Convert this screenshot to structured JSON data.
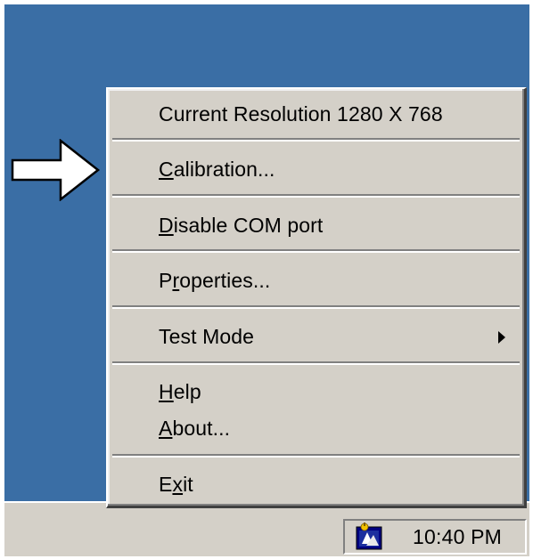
{
  "menu": {
    "resolution_label": "Current Resolution  1280 X 768",
    "calibration": {
      "mnemonic": "C",
      "rest": "alibration..."
    },
    "disable_com": {
      "mnemonic": "D",
      "rest": "isable COM port"
    },
    "properties": {
      "before": "P",
      "mnemonic": "r",
      "rest": "operties..."
    },
    "test_mode_label": "Test Mode",
    "help": {
      "mnemonic": "H",
      "rest": "elp"
    },
    "about": {
      "mnemonic": "A",
      "rest": "bout..."
    },
    "exit": {
      "before": "E",
      "mnemonic": "x",
      "rest": "it"
    }
  },
  "taskbar": {
    "clock": "10:40 PM",
    "tray_icon": "touchscreen-utility-icon"
  },
  "pointer": {
    "icon": "white-arrow-right-icon"
  },
  "colors": {
    "desktop": "#3a6ea5",
    "menu_face": "#d4d0c8",
    "text": "#000000"
  }
}
